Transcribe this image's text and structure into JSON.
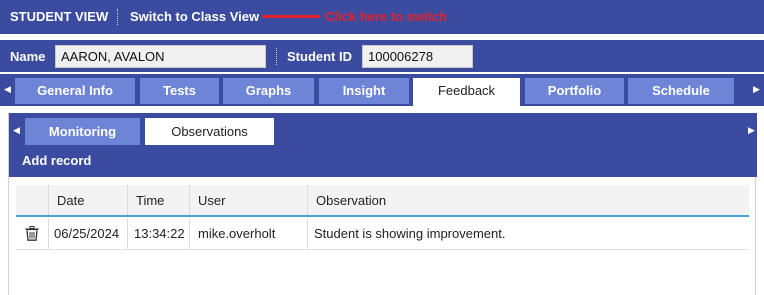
{
  "topbar": {
    "view_label": "STUDENT VIEW",
    "switch_link": "Switch to Class View",
    "hint": "Click here to switch"
  },
  "student": {
    "name_label": "Name",
    "name_value": "AARON, AVALON",
    "id_label": "Student ID",
    "id_value": "100006278"
  },
  "tabs": [
    {
      "label": "General Info"
    },
    {
      "label": "Tests"
    },
    {
      "label": "Graphs"
    },
    {
      "label": "Insight"
    },
    {
      "label": "Feedback",
      "active": true
    },
    {
      "label": "Portfolio"
    },
    {
      "label": "Schedule"
    }
  ],
  "subtabs": [
    {
      "label": "Monitoring"
    },
    {
      "label": "Observations",
      "active": true
    }
  ],
  "actions": {
    "add_record": "Add record"
  },
  "table": {
    "columns": [
      "",
      "Date",
      "Time",
      "User",
      "Observation"
    ],
    "rows": [
      {
        "date": "06/25/2024",
        "time": "13:34:22",
        "user": "mike.overholt",
        "observation": "Student is showing improvement."
      }
    ]
  },
  "icons": {
    "trash": "trash-icon",
    "left_arrow": "caret-left-icon",
    "right_arrow": "caret-right-icon"
  },
  "colors": {
    "primary": "#3b4ba0",
    "tab": "#6e84d6",
    "hint": "#e0232b",
    "grid_accent": "#4aa3d6"
  }
}
